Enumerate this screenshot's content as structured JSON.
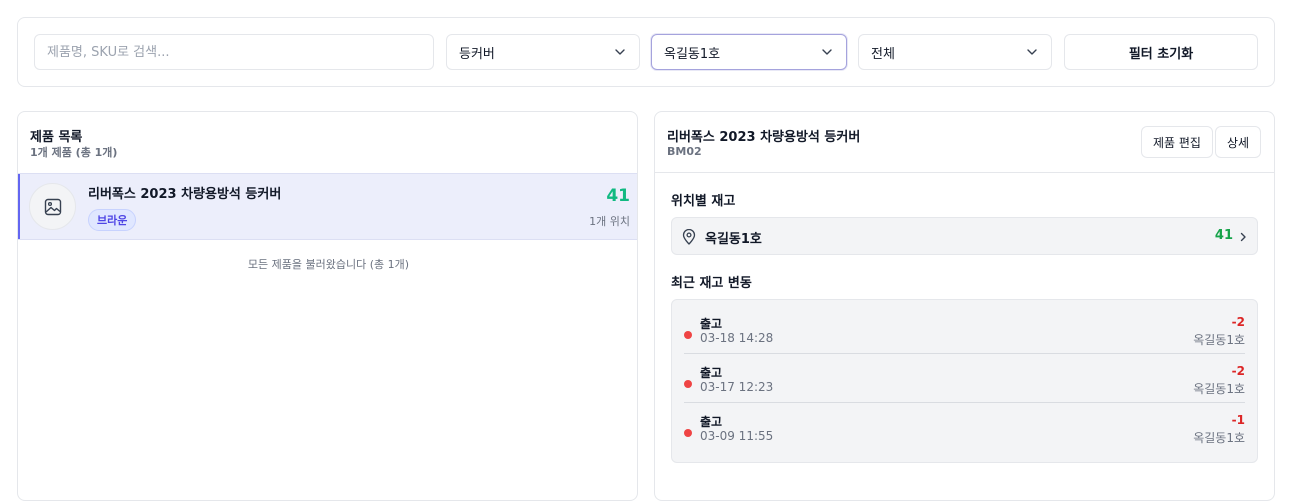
{
  "filters": {
    "search_placeholder": "제품명, SKU로 검색...",
    "category": "등커버",
    "location": "옥길동1호",
    "status": "전체",
    "reset_label": "필터 초기화"
  },
  "product_list": {
    "title": "제품 목록",
    "subtitle": "1개 제품 (총 1개)",
    "items": [
      {
        "name": "리버폭스 2023 차량용방석 등커버",
        "badge": "브라운",
        "quantity": "41",
        "locations": "1개 위치"
      }
    ],
    "footer": "모든 제품을 불러왔습니다 (총 1개)"
  },
  "detail": {
    "title": "리버폭스 2023 차량용방석 등커버",
    "sku": "BM02",
    "edit_label": "제품 편집",
    "detail_label": "상세",
    "stock_section_title": "위치별 재고",
    "stock_locations": [
      {
        "name": "옥길동1호",
        "quantity": "41"
      }
    ],
    "history_section_title": "최근 재고 변동",
    "history": [
      {
        "type": "출고",
        "date": "03-18 14:28",
        "change": "-2",
        "location": "옥길동1호"
      },
      {
        "type": "출고",
        "date": "03-17 12:23",
        "change": "-2",
        "location": "옥길동1호"
      },
      {
        "type": "출고",
        "date": "03-09 11:55",
        "change": "-1",
        "location": "옥길동1호"
      }
    ]
  },
  "icons": {
    "chevron": "chevron-down-icon",
    "image_placeholder": "image-icon",
    "location_pin": "map-pin-icon",
    "chevron_right": "chevron-right-icon"
  },
  "colors": {
    "accent": "#6366f1",
    "positive_qty": "#10b981",
    "negative_change": "#dc2626",
    "selected_row_bg": "#eceefb"
  }
}
